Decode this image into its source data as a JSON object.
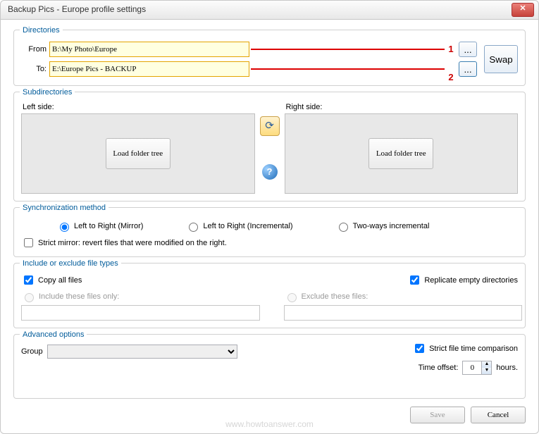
{
  "window": {
    "title": "Backup Pics - Europe profile settings"
  },
  "directories": {
    "legend": "Directories",
    "from_label": "From",
    "from_value": "B:\\My Photo\\Europe",
    "to_label": "To:",
    "to_value": "E:\\Europe Pics - BACKUP",
    "marker1": "1",
    "marker2": "2",
    "browse": "...",
    "swap": "Swap"
  },
  "subdirs": {
    "legend": "Subdirectories",
    "left_label": "Left side:",
    "right_label": "Right side:",
    "load_btn": "Load folder tree"
  },
  "sync": {
    "legend": "Synchronization method",
    "opt1": "Left to Right (Mirror)",
    "opt2": "Left to Right (Incremental)",
    "opt3": "Two-ways incremental",
    "strict": "Strict mirror: revert files that were modified on the right."
  },
  "include": {
    "legend": "Include or exclude file types",
    "copy_all": "Copy all files",
    "replicate": "Replicate empty directories",
    "only": "Include these files only:",
    "exclude": "Exclude these files:"
  },
  "advanced": {
    "legend": "Advanced options",
    "group_label": "Group",
    "strict_time": "Strict file time comparison",
    "offset_label": "Time offset:",
    "offset_value": "0",
    "hours": "hours."
  },
  "footer": {
    "save": "Save",
    "cancel": "Cancel"
  },
  "watermark": "www.howtoanswer.com"
}
